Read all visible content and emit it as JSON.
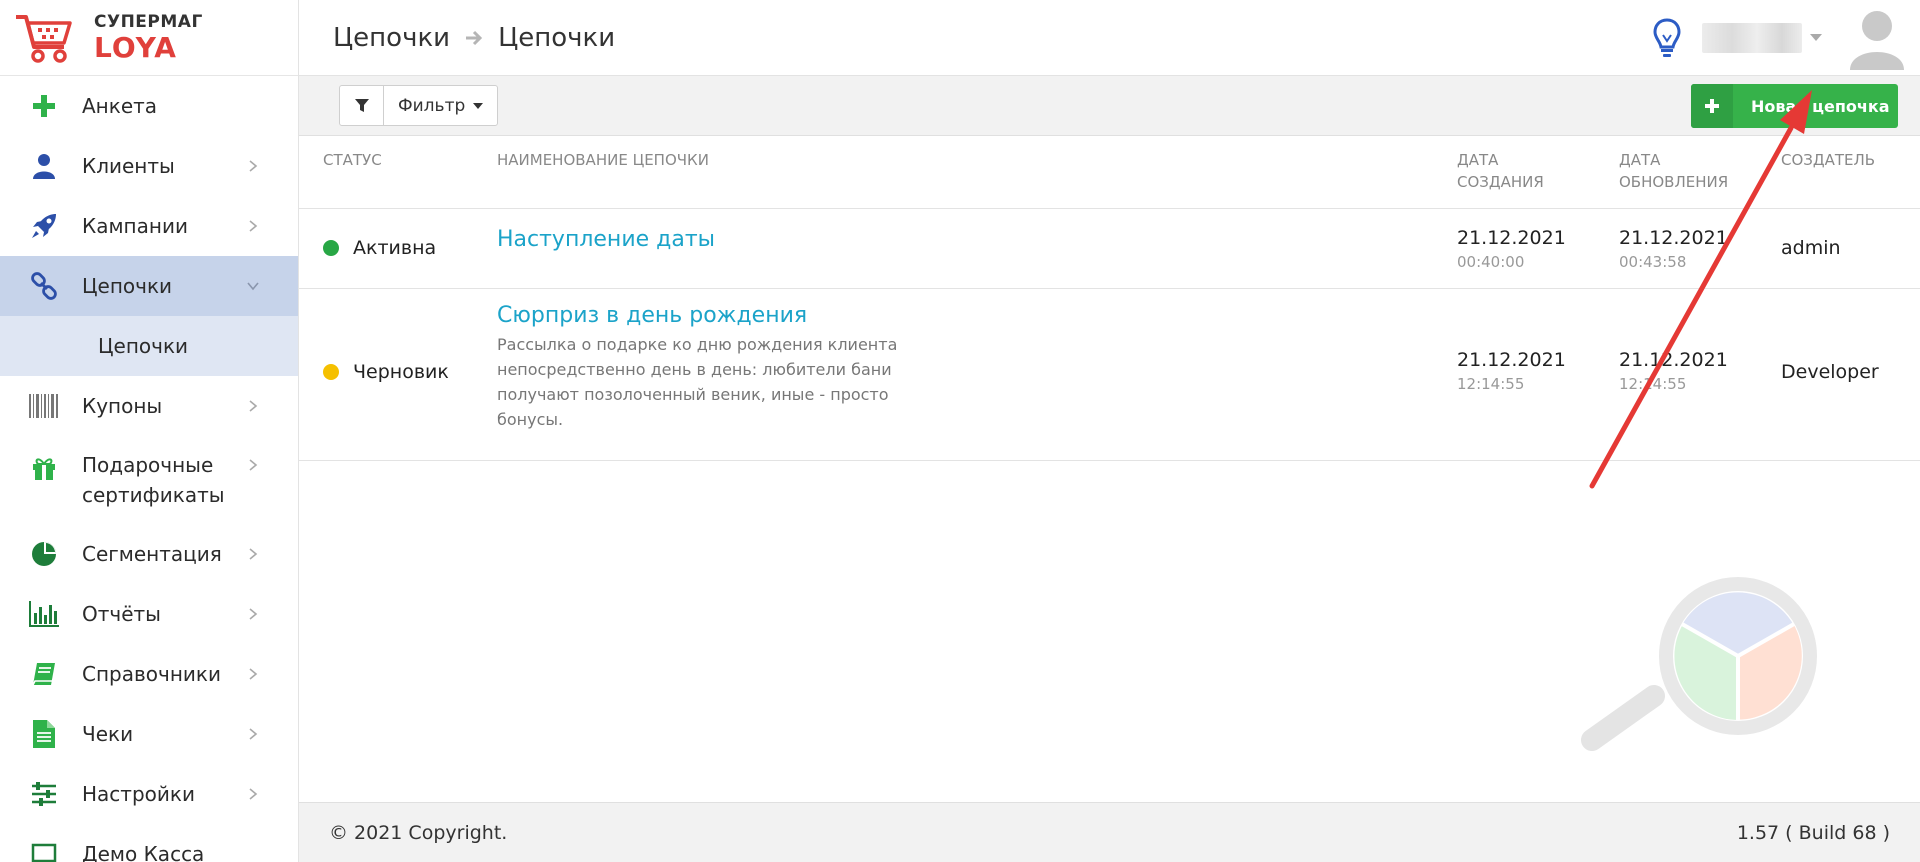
{
  "logo": {
    "line1": "СУПЕРМАГ",
    "line2": "LOYA"
  },
  "sidebar": {
    "items": [
      {
        "label": "Анкета",
        "icon": "plus-icon"
      },
      {
        "label": "Клиенты",
        "icon": "user-icon"
      },
      {
        "label": "Кампании",
        "icon": "rocket-icon"
      },
      {
        "label": "Цепочки",
        "icon": "link-icon",
        "active": true
      },
      {
        "label": "Купоны",
        "icon": "barcode-icon"
      },
      {
        "label": "Подарочные сертификаты",
        "icon": "gift-icon"
      },
      {
        "label": "Сегментация",
        "icon": "pie-chart-icon"
      },
      {
        "label": "Отчёты",
        "icon": "bar-chart-icon"
      },
      {
        "label": "Справочники",
        "icon": "book-icon"
      },
      {
        "label": "Чеки",
        "icon": "receipt-icon"
      },
      {
        "label": "Настройки",
        "icon": "sliders-icon"
      },
      {
        "label": "Демо Касса",
        "icon": "monitor-icon"
      }
    ],
    "subitem": "Цепочки"
  },
  "header": {
    "crumb1": "Цепочки",
    "crumb2": "Цепочки"
  },
  "toolbar": {
    "filter_label": "Фильтр",
    "new_label": "Новая цепочка"
  },
  "table": {
    "headers": {
      "status": "Статус",
      "name": "Наименование цепочки",
      "created_1": "Дата",
      "created_2": "создания",
      "updated_1": "Дата",
      "updated_2": "обновления",
      "creator": "Создатель"
    },
    "rows": [
      {
        "status": "Активна",
        "status_color": "#28a745",
        "name": "Наступление даты",
        "description": "",
        "created_date": "21.12.2021",
        "created_time": "00:40:00",
        "updated_date": "21.12.2021",
        "updated_time": "00:43:58",
        "creator": "admin"
      },
      {
        "status": "Черновик",
        "status_color": "#f5c000",
        "name": "Сюрприз в день рождения",
        "description": "Рассылка о подарке ко дню рождения клиента непосредственно день в день: любители бани получают позолоченный веник, иные - просто бонусы.",
        "created_date": "21.12.2021",
        "created_time": "12:14:55",
        "updated_date": "21.12.2021",
        "updated_time": "12:14:55",
        "creator": "Developer"
      }
    ]
  },
  "footer": {
    "copyright": "© 2021 Copyright.",
    "version": "1.57 ( Build 68 )"
  },
  "colors": {
    "accent_green": "#36b24a",
    "link_blue": "#1ba3c9",
    "sidebar_active": "#c6d3ea",
    "logo_red": "#e0403b",
    "annotation_red": "#e53935"
  }
}
